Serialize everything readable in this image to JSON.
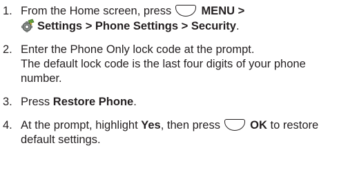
{
  "steps": [
    {
      "num": "1.",
      "t1": "From the Home screen, press",
      "t2": "MENU",
      "t3": ">",
      "t4": "Settings",
      "t5": ">",
      "t6": "Phone Settings",
      "t7": ">",
      "t8": "Security",
      "t9": "."
    },
    {
      "num": "2.",
      "line1": "Enter the Phone Only lock code at the prompt.",
      "line2": "The default lock code is the last four digits of your phone number."
    },
    {
      "num": "3.",
      "t1": "Press",
      "t2": "Restore Phone",
      "t3": "."
    },
    {
      "num": "4.",
      "t1": "At the prompt, highlight",
      "t2": "Yes",
      "t3": ", then press",
      "t4": "OK",
      "t5": "to restore default settings."
    }
  ],
  "icons": {
    "softkey": "softkey-icon",
    "settings": "settings-gear-icon"
  }
}
